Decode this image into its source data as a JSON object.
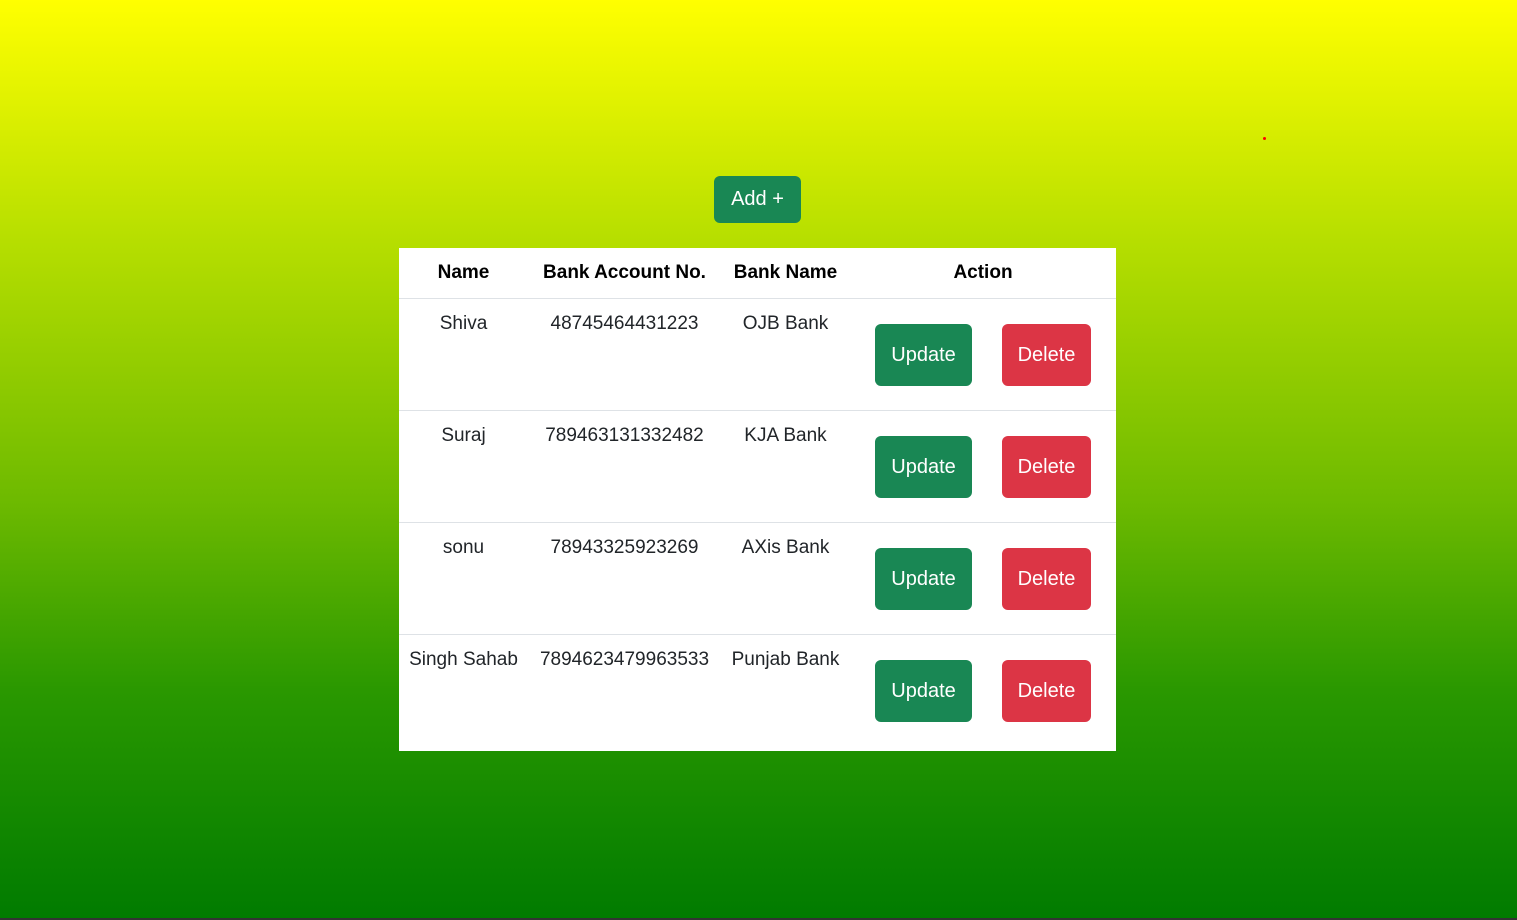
{
  "toolbar": {
    "add_label": "Add +"
  },
  "table": {
    "headers": [
      "Name",
      "Bank Account No.",
      "Bank Name",
      "Action"
    ],
    "rows": [
      {
        "name": "Shiva",
        "account": "48745464431223",
        "bank": "OJB Bank",
        "update_label": "Update",
        "delete_label": "Delete"
      },
      {
        "name": "Suraj",
        "account": "789463131332482",
        "bank": "KJA Bank",
        "update_label": "Update",
        "delete_label": "Delete"
      },
      {
        "name": "sonu",
        "account": "78943325923269",
        "bank": "AXis Bank",
        "update_label": "Update",
        "delete_label": "Delete"
      },
      {
        "name": "Singh Sahab",
        "account": "7894623479963533",
        "bank": "Punjab Bank",
        "update_label": "Update",
        "delete_label": "Delete"
      }
    ]
  },
  "colors": {
    "primary_green": "#198754",
    "danger_red": "#dc3545",
    "gradient_top": "#ffff00",
    "gradient_bottom": "#007b00"
  }
}
